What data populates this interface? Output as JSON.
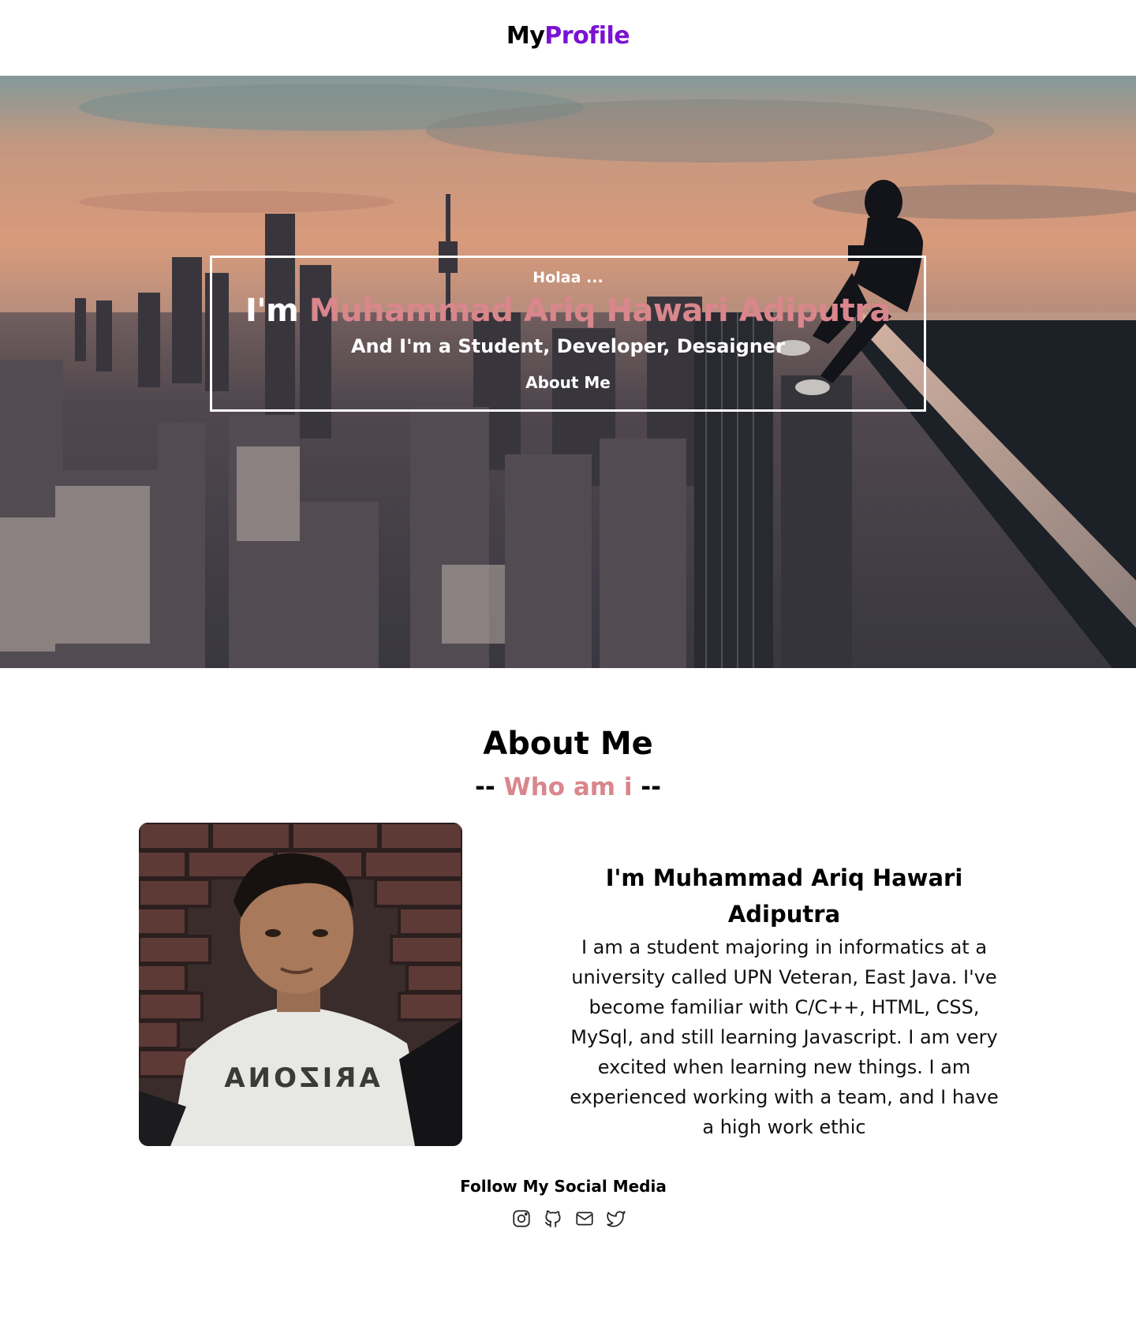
{
  "header": {
    "logo_part1": "My",
    "logo_part2": "Profile"
  },
  "hero": {
    "greeting": "Holaa ...",
    "intro_prefix": "I'm",
    "name": "Muhammad Ariq Hawari Adiputra",
    "roles": "And I'm a Student, Developer, Desaigner",
    "cta": "About Me"
  },
  "about": {
    "title": "About Me",
    "subtitle_prefix": "--",
    "subtitle": "Who am i",
    "subtitle_suffix": "--",
    "name_heading": "I'm Muhammad Ariq Hawari Adiputra",
    "bio": "I am a student majoring in informatics at a university called UPN Veteran, East Java. I've become familiar with C/C++, HTML, CSS, MySql, and still learning Javascript. I am very excited when learning new things. I am experienced working with a team, and I have a high work ethic",
    "photo_shirt_text": "ARIZONA"
  },
  "social": {
    "heading": "Follow My Social Media",
    "icons": [
      "instagram-icon",
      "github-icon",
      "mail-icon",
      "twitter-icon"
    ]
  },
  "colors": {
    "accent_pink": "#d9868c",
    "brand_purple": "#7a12d4"
  }
}
